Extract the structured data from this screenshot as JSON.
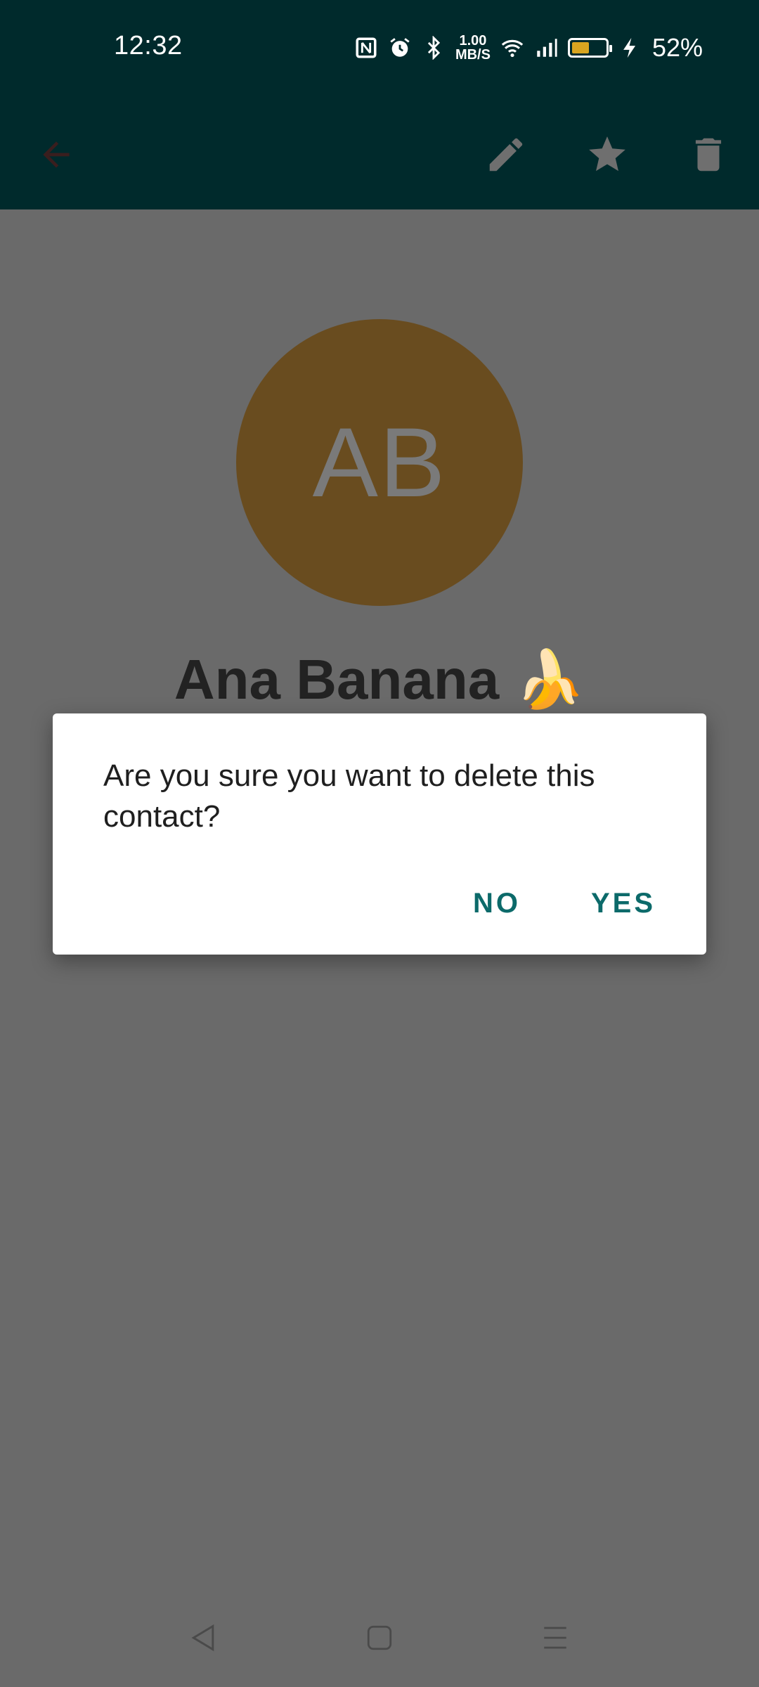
{
  "status_bar": {
    "time": "12:32",
    "net_speed_value": "1.00",
    "net_speed_unit": "MB/S",
    "battery_percent": "52%",
    "battery_level": 0.52,
    "icons": [
      "nfc-icon",
      "alarm-icon",
      "bluetooth-icon",
      "wifi-icon",
      "signal-icon",
      "battery-icon",
      "charging-icon"
    ]
  },
  "app_bar": {
    "icons": [
      "back-arrow-icon",
      "edit-icon",
      "star-icon",
      "delete-icon"
    ]
  },
  "contact": {
    "initials": "AB",
    "name": "Ana Banana 🍌",
    "avatar_color": "#e0a43e"
  },
  "dialog": {
    "message": "Are you sure you want to delete this contact?",
    "no_label": "NO",
    "yes_label": "YES",
    "accent_color": "#0c6a6a"
  },
  "nav_bar": {
    "icons": [
      "back-triangle-icon",
      "home-square-icon",
      "recents-menu-icon"
    ]
  }
}
